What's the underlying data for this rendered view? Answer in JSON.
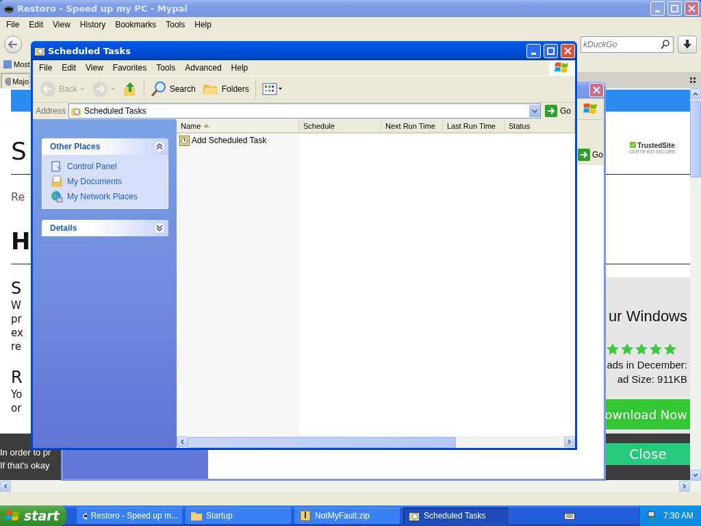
{
  "browser": {
    "title": "Restoro - Speed up my PC - Mypal",
    "active": false,
    "menu": [
      "File",
      "Edit",
      "View",
      "History",
      "Bookmarks",
      "Tools",
      "Help"
    ],
    "search": {
      "placeholder": "kDuckGo"
    },
    "bookmark": "Most",
    "tab": "Majo",
    "page": {
      "fragments": [
        {
          "kind": "h1",
          "text": "S"
        },
        {
          "kind": "sub",
          "text": "Re"
        },
        {
          "kind": "h1b",
          "text": "H"
        },
        {
          "kind": "h2",
          "text": "S"
        },
        {
          "kind": "p",
          "text": "W"
        },
        {
          "kind": "p",
          "text": "pr"
        },
        {
          "kind": "p",
          "text": "ex"
        },
        {
          "kind": "p",
          "text": "re"
        },
        {
          "kind": "h2",
          "text": "R"
        },
        {
          "kind": "p",
          "text": "Yo"
        },
        {
          "kind": "p",
          "text": "or"
        }
      ],
      "badge": {
        "name": "TrustedSite",
        "caption": "CERTIFIED SECURE"
      },
      "promo": {
        "heading": "ur Windows",
        "stars": 5,
        "lines": [
          "ads in December:",
          "ad Size: 911KB"
        ],
        "download": "ownload Now",
        "close": "Close"
      },
      "cookie_lines": [
        "In order to pr",
        "If that's okay"
      ]
    }
  },
  "back_window": {
    "active": false,
    "go": "Go"
  },
  "window": {
    "title": "Scheduled Tasks",
    "active": true,
    "menu": [
      "File",
      "Edit",
      "View",
      "Favorites",
      "Tools",
      "Advanced",
      "Help"
    ],
    "toolbar": [
      {
        "kind": "back",
        "label": "Back",
        "disabled": true
      },
      {
        "kind": "forward",
        "disabled": true
      },
      {
        "kind": "up",
        "disabled": false
      },
      {
        "kind": "search",
        "label": "Search",
        "disabled": false
      },
      {
        "kind": "folders",
        "label": "Folders",
        "disabled": false
      },
      {
        "kind": "views",
        "disabled": false
      }
    ],
    "address": {
      "label": "Address",
      "value": "Scheduled Tasks",
      "go": "Go"
    },
    "panels": [
      {
        "title": "Other Places",
        "expanded": true,
        "items": [
          {
            "kind": "control",
            "label": "Control Panel"
          },
          {
            "kind": "docs",
            "label": "My Documents"
          },
          {
            "kind": "network",
            "label": "My Network Places"
          }
        ]
      },
      {
        "title": "Details",
        "expanded": false
      }
    ],
    "columns": [
      {
        "label": "Name",
        "sorted": true
      },
      {
        "label": "Schedule",
        "sorted": false
      },
      {
        "label": "Next Run Time",
        "sorted": false
      },
      {
        "label": "Last Run Time",
        "sorted": false
      },
      {
        "label": "Status",
        "sorted": false
      }
    ],
    "rows": [
      "Add Scheduled Task"
    ]
  },
  "taskbar": {
    "start": "start",
    "buttons": [
      {
        "kind": "browser",
        "label": "Restoro - Speed up m...",
        "selected": false
      },
      {
        "kind": "folder",
        "label": "Startup",
        "selected": false
      },
      {
        "kind": "zip",
        "label": "NotMyFault.zip",
        "selected": false
      },
      {
        "kind": "tasks",
        "label": "Scheduled Tasks",
        "selected": true
      }
    ],
    "clock": "7:30 AM"
  }
}
